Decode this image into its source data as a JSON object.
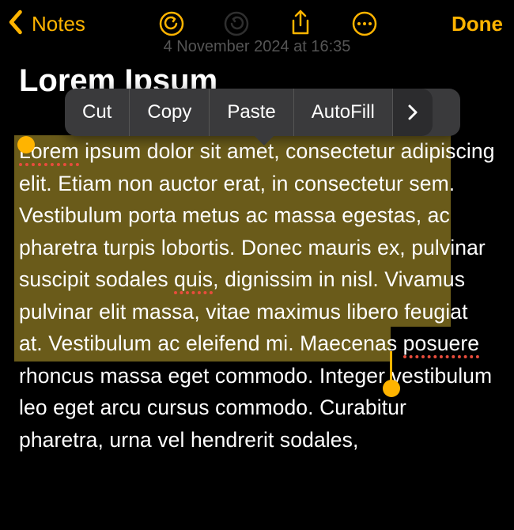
{
  "toolbar": {
    "back_label": "Notes",
    "done_label": "Done"
  },
  "date_row": "4 November 2024 at 16:35",
  "note": {
    "title": "Lorem Ipsum",
    "body_part1": "Lorem",
    "body_part2": " ipsum dolor sit amet, consectetur adipiscing elit. Etiam non auctor erat, in consectetur sem. Vestibulum porta metus ac massa egestas, ac pharetra turpis lobortis. Donec mauris ex, pulvinar suscipit sodales ",
    "body_part3": "quis",
    "body_part4": ", dignissim in nisl. Vivamus pulvinar elit massa, vitae maximus libero feugiat at. Vestibulum ac eleifend mi. Maecenas ",
    "body_part5": "posuere",
    "body_part6": " rhoncus massa eget commodo. Integer vestibulum leo eget arcu cursus commodo. Curabitur pharetra, urna vel hendrerit sodales,"
  },
  "context_menu": {
    "cut": "Cut",
    "copy": "Copy",
    "paste": "Paste",
    "autofill": "AutoFill"
  }
}
